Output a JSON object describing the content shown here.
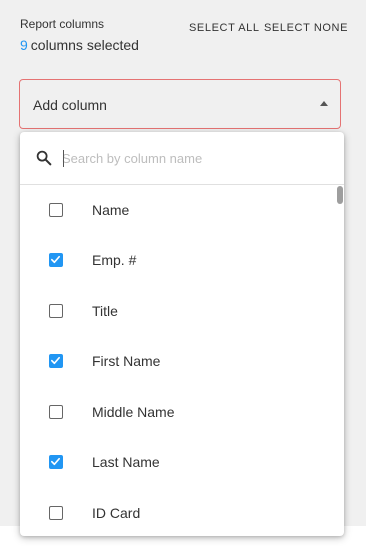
{
  "header": {
    "title": "Report columns",
    "count": "9",
    "count_suffix": "columns selected",
    "select_all": "SELECT ALL",
    "select_none": "SELECT NONE"
  },
  "select": {
    "label": "Add column"
  },
  "search": {
    "placeholder": "Search by column name",
    "value": ""
  },
  "columns": [
    {
      "label": "Name",
      "checked": false
    },
    {
      "label": "Emp. #",
      "checked": true
    },
    {
      "label": "Title",
      "checked": false
    },
    {
      "label": "First Name",
      "checked": true
    },
    {
      "label": "Middle Name",
      "checked": false
    },
    {
      "label": "Last Name",
      "checked": true
    },
    {
      "label": "ID Card",
      "checked": false
    }
  ],
  "colors": {
    "accent": "#2196f3",
    "error_border": "#e57373"
  }
}
